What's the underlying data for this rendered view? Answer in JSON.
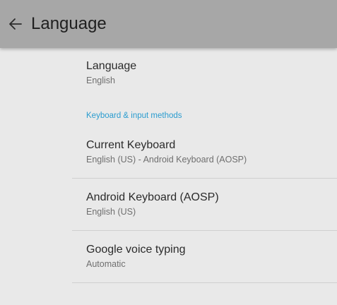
{
  "appbar": {
    "title": "Language",
    "back_icon": "arrow-left-icon"
  },
  "preferences": {
    "language": {
      "title": "Language",
      "summary": "English"
    },
    "section_header": "Keyboard & input methods",
    "current_keyboard": {
      "title": "Current Keyboard",
      "summary": "English (US) - Android Keyboard (AOSP)"
    },
    "android_keyboard": {
      "title": "Android Keyboard (AOSP)",
      "summary": "English (US)"
    },
    "google_voice": {
      "title": "Google voice typing",
      "summary": "Automatic"
    }
  },
  "colors": {
    "appbar_bg": "#a7a7a7",
    "page_bg": "#e9e9e9",
    "accent": "#2a9ccf"
  }
}
